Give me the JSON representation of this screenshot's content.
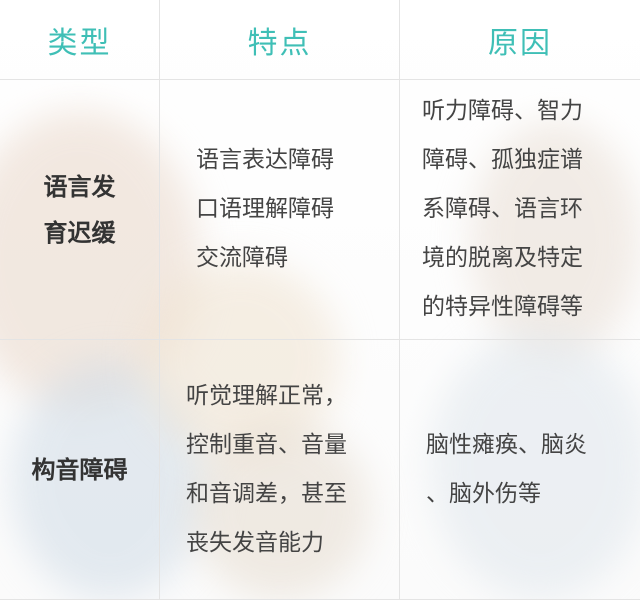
{
  "table": {
    "headers": [
      "类型",
      "特点",
      "原因"
    ],
    "rows": [
      {
        "type_lines": [
          "语言发",
          "育迟缓"
        ],
        "features_lines": [
          "语言表达障碍",
          "口语理解障碍",
          "交流障碍"
        ],
        "reasons_lines": [
          "听力障碍、智力",
          "障碍、孤独症谱",
          "系障碍、语言环",
          "境的脱离及特定",
          "的特异性障碍等"
        ]
      },
      {
        "type_lines": [
          "构音障碍"
        ],
        "features_lines": [
          "听觉理解正常，",
          "控制重音、音量",
          "和音调差，甚至",
          "丧失发音能力"
        ],
        "reasons_lines": [
          "脑性瘫痪、脑炎",
          "、脑外伤等"
        ]
      }
    ]
  },
  "colors": {
    "header": "#3fbfb6",
    "type_text": "#333333",
    "body_text": "#444444",
    "grid_line": "#e4e4e4"
  }
}
